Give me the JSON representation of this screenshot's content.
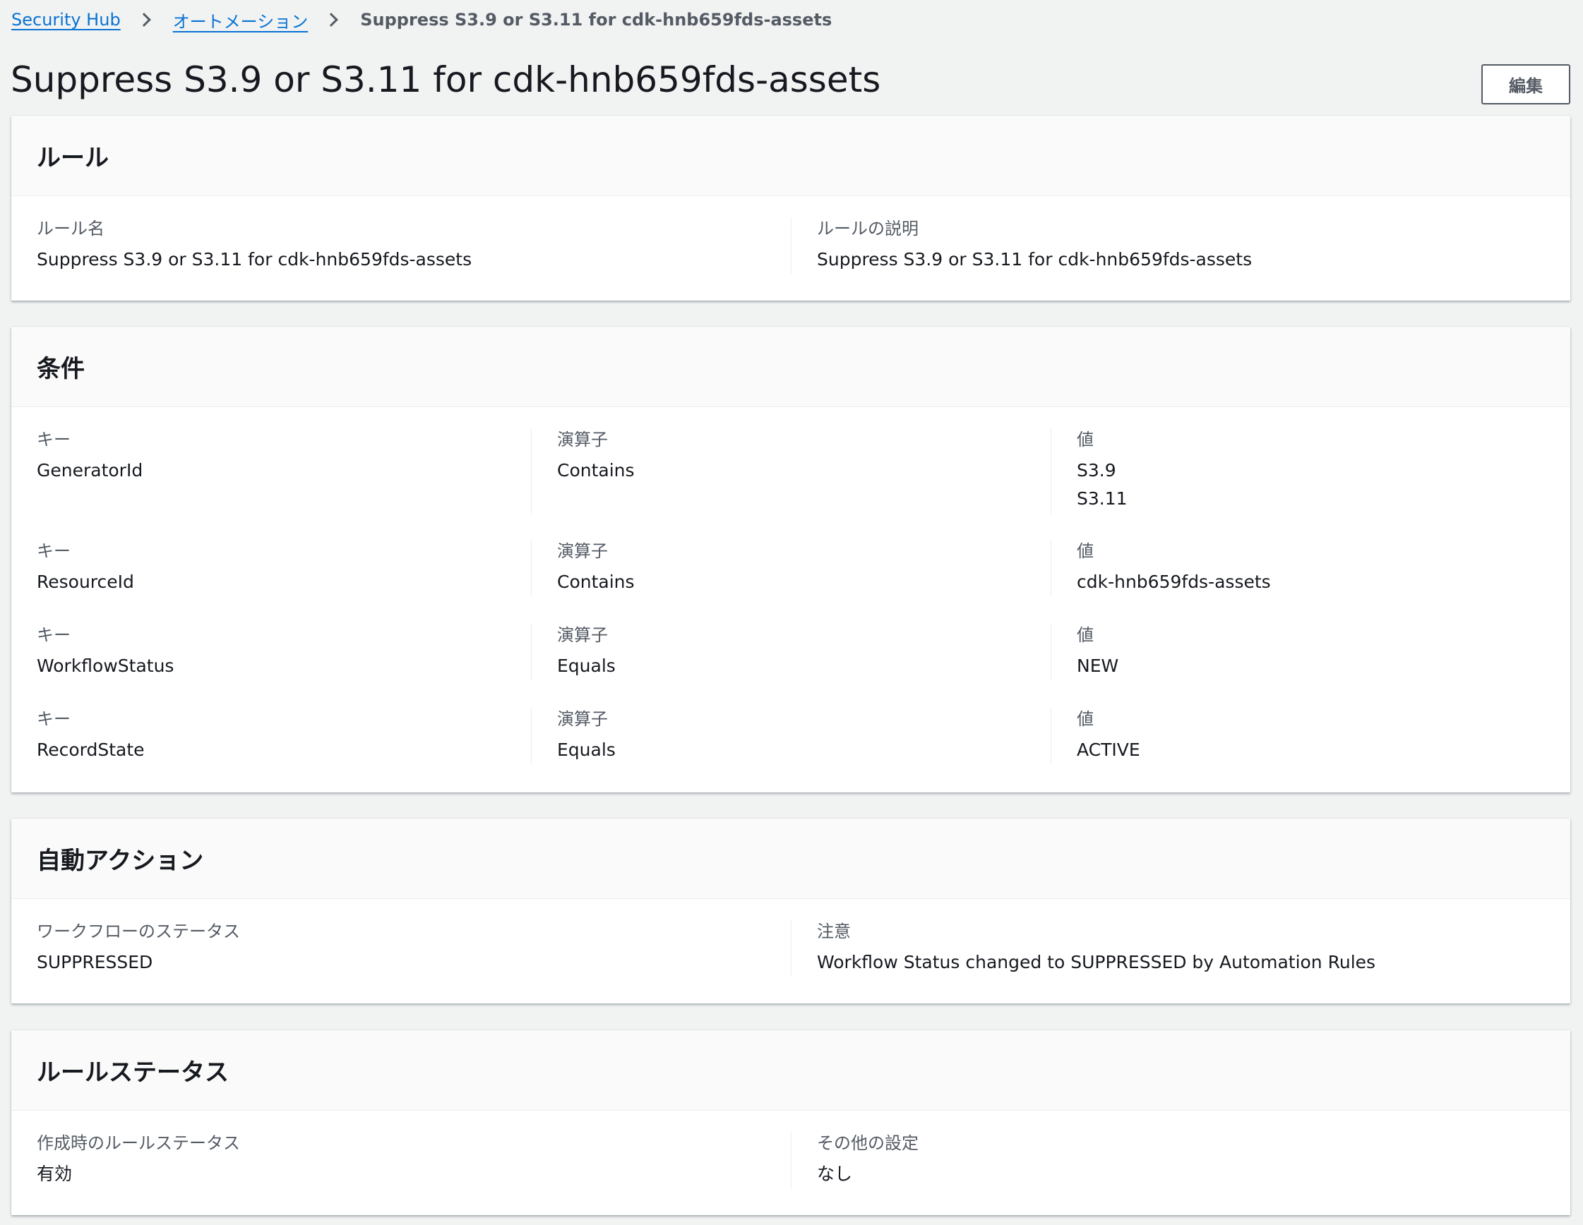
{
  "breadcrumb": {
    "items": [
      "Security Hub",
      "オートメーション"
    ],
    "current": "Suppress S3.9 or S3.11 for cdk-hnb659fds-assets"
  },
  "title": "Suppress S3.9 or S3.11 for cdk-hnb659fds-assets",
  "edit_label": "編集",
  "rule": {
    "heading": "ルール",
    "name_label": "ルール名",
    "name_value": "Suppress S3.9 or S3.11 for cdk-hnb659fds-assets",
    "desc_label": "ルールの説明",
    "desc_value": "Suppress S3.9 or S3.11 for cdk-hnb659fds-assets"
  },
  "conditions": {
    "heading": "条件",
    "key_label": "キー",
    "operator_label": "演算子",
    "value_label": "値",
    "rows": [
      {
        "key": "GeneratorId",
        "operator": "Contains",
        "values": [
          "S3.9",
          "S3.11"
        ]
      },
      {
        "key": "ResourceId",
        "operator": "Contains",
        "values": [
          "cdk-hnb659fds-assets"
        ]
      },
      {
        "key": "WorkflowStatus",
        "operator": "Equals",
        "values": [
          "NEW"
        ]
      },
      {
        "key": "RecordState",
        "operator": "Equals",
        "values": [
          "ACTIVE"
        ]
      }
    ]
  },
  "actions": {
    "heading": "自動アクション",
    "status_label": "ワークフローのステータス",
    "status_value": "SUPPRESSED",
    "note_label": "注意",
    "note_value": "Workflow Status changed to SUPPRESSED by Automation Rules"
  },
  "rule_status": {
    "heading": "ルールステータス",
    "created_label": "作成時のルールステータス",
    "created_value": "有効",
    "other_label": "その他の設定",
    "other_value": "なし"
  },
  "colors": {
    "link": "#0972d3",
    "background": "#f1f2f2",
    "text": "#16191f",
    "label": "#545b64"
  }
}
